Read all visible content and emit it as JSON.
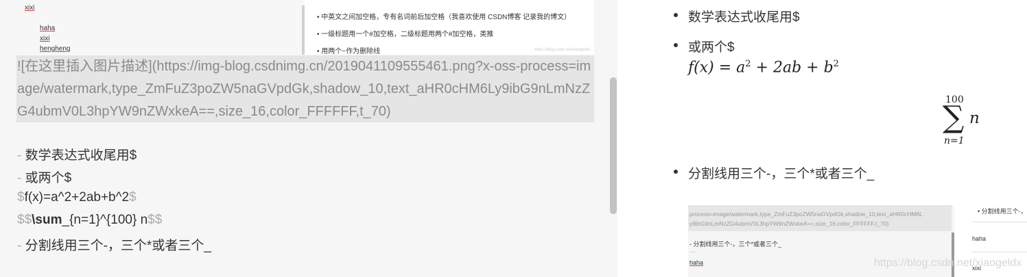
{
  "editor": {
    "embedded_top": {
      "left_lines": [
        "xixi",
        "haha",
        "xixi",
        "hengheng"
      ],
      "right_bullets": [
        "中英文之间加空格，专有名词前后加空格（我喜欢使用 CSDN博客 记录我的博文）",
        "一级标题用一个#加空格，二级标题用两个#加空格，类推",
        "用两个~作为删除线"
      ],
      "watermark": "https://blog.csdn.net/xiaogeldx"
    },
    "image_link": "![在这里插入图片描述](https://img-blog.csdnimg.cn/2019041109555461.png?x-oss-process=image/watermark,type_ZmFuZ3poZW5naGVpdGk,shadow_10,text_aHR0cHM6Ly9ibG9nLmNzZG4ubmV0L3hpYW9nZWxkeA==,size_16,color_FFFFFF,t_70)",
    "lines": {
      "l1_marker": "- ",
      "l1_text": "数学表达式收尾用$",
      "l2_marker": "- ",
      "l2_text": "或两个$",
      "l3_open": "$",
      "l3_text": "f(x)=a^2+2ab+b^2",
      "l3_close": "$",
      "l4_open": "$$",
      "l4_cmd": "\\sum",
      "l4_text": "_{n=1}^{100} n",
      "l4_close": "$$",
      "l5_marker": "- ",
      "l5_text": "分割线用三个-，三个*或者三个_"
    }
  },
  "preview": {
    "bullet1": "数学表达式收尾用$",
    "bullet2": "或两个$",
    "formula": {
      "lhs": "f(x) = a",
      "exp1": "2",
      "mid": " + 2ab + b",
      "exp2": "2"
    },
    "sum": {
      "upper": "100",
      "symbol": "∑",
      "body": "n",
      "lower": "n=1"
    },
    "bullet3": "分割线用三个-，三个*或者三个_",
    "embedded_bottom": {
      "band_lines": [
        "process=image/watermark,type_ZmFuZ3poZW5naGVpdGk,shadow_10,text_aHR0cHM6L",
        "y9ibG9nLmNzZG4ubmV0L3hpYW9nZWxkeA==,size_16,color_FFFFFF,t_70)"
      ],
      "line_a": "- 分割线用三个-，三个*或者三个_",
      "line_b": "---",
      "line_c": "haha",
      "right_items": [
        "• 分割线用三个-，",
        "haha",
        "xixi"
      ]
    },
    "watermark": "https://blog.csdn.net/xiaogeldx"
  }
}
